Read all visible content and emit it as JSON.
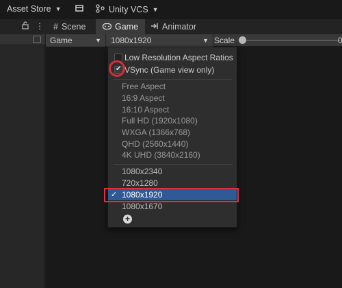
{
  "topbar": {
    "asset_store": "Asset Store",
    "vcs": "Unity VCS"
  },
  "tabs": [
    {
      "label": "Scene",
      "icon": "grid-icon"
    },
    {
      "label": "Game",
      "icon": "gamepad-icon",
      "active": true
    },
    {
      "label": "Animator",
      "icon": "animator-icon"
    }
  ],
  "game_toolbar": {
    "display": "Game",
    "resolution": "1080x1920",
    "scale_label": "Scale",
    "scale_value": "0"
  },
  "menu": {
    "low_res": {
      "label": "Low Resolution Aspect Ratios",
      "checked": false
    },
    "vsync": {
      "label": "VSync (Game view only)",
      "checked": true
    },
    "presets": [
      "Free Aspect",
      "16:9 Aspect",
      "16:10 Aspect",
      "Full HD (1920x1080)",
      "WXGA (1366x768)",
      "QHD (2560x1440)",
      "4K UHD (3840x2160)"
    ],
    "custom": [
      "1080x2340",
      "720x1280",
      "1080x1920",
      "1080x1670"
    ],
    "selected": "1080x1920"
  },
  "colors": {
    "highlight": "#2f5a96",
    "annotation": "#e0303c"
  }
}
